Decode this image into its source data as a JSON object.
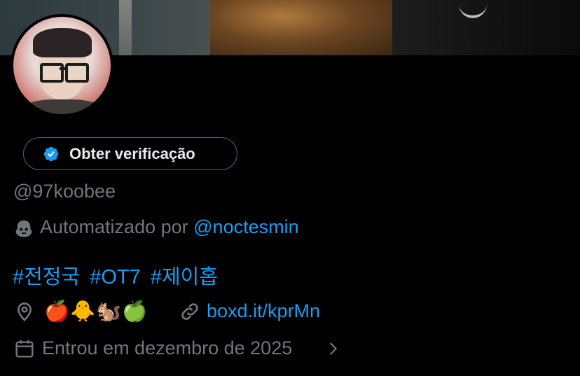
{
  "verify": {
    "label": "Obter verificação"
  },
  "profile": {
    "handle": "@97koobee",
    "automated_prefix": "Automatizado por",
    "automated_by": "@noctesmin",
    "hashtags": [
      "#전정국",
      "#OT7",
      "#제이홉"
    ],
    "location": "🍎🐥🐿️🍏",
    "link": "boxd.it/kprMn",
    "joined": "Entrou em dezembro de 2025"
  },
  "colors": {
    "accent": "#1d9bf0",
    "muted": "#71767b",
    "text": "#e7e9ea",
    "background": "#000000",
    "border": "#536471"
  },
  "icons": [
    "verified-badge-icon",
    "bot-icon",
    "location-pin-icon",
    "link-icon",
    "calendar-icon",
    "chevron-right-icon"
  ]
}
